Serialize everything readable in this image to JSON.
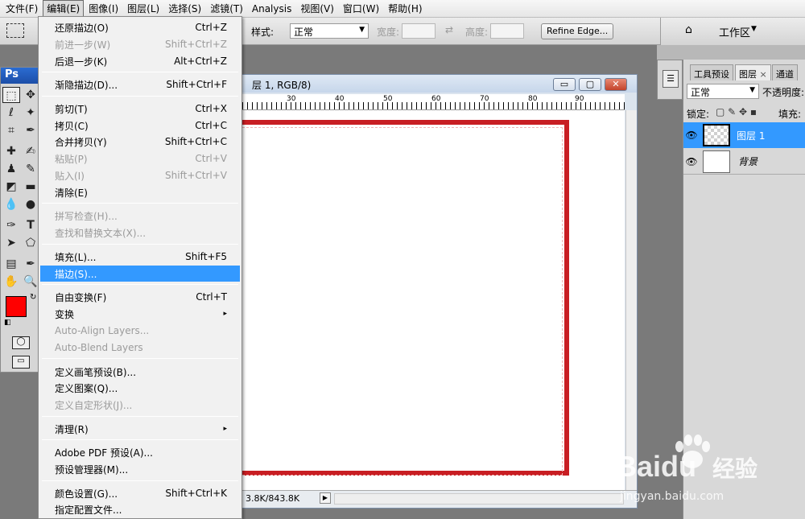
{
  "menubar": {
    "items": [
      "文件(F)",
      "编辑(E)",
      "图像(I)",
      "图层(L)",
      "选择(S)",
      "滤镜(T)",
      "Analysis",
      "视图(V)",
      "窗口(W)",
      "帮助(H)"
    ]
  },
  "options": {
    "style_label": "样式:",
    "style_value": "正常",
    "width_label": "宽度:",
    "height_label": "高度:",
    "refine_label": "Refine Edge...",
    "workspace_label": "工作区"
  },
  "toolbox": {
    "title": "Ps"
  },
  "document": {
    "title": "层 1, RGB/8)",
    "ruler_numbers": [
      "30",
      "40",
      "50",
      "60",
      "70",
      "80",
      "90"
    ],
    "status_text": "3.8K/843.8K",
    "win_minimize": "▭",
    "win_maximize": "▢",
    "win_close": "✕"
  },
  "edit_menu": {
    "items": [
      {
        "label": "还原描边(O)",
        "shortcut": "Ctrl+Z",
        "disabled": false
      },
      {
        "label": "前进一步(W)",
        "shortcut": "Shift+Ctrl+Z",
        "disabled": true
      },
      {
        "label": "后退一步(K)",
        "shortcut": "Alt+Ctrl+Z",
        "disabled": false
      },
      {
        "label": "渐隐描边(D)...",
        "shortcut": "Shift+Ctrl+F",
        "disabled": false
      },
      {
        "label": "剪切(T)",
        "shortcut": "Ctrl+X",
        "disabled": false
      },
      {
        "label": "拷贝(C)",
        "shortcut": "Ctrl+C",
        "disabled": false
      },
      {
        "label": "合并拷贝(Y)",
        "shortcut": "Shift+Ctrl+C",
        "disabled": false
      },
      {
        "label": "粘贴(P)",
        "shortcut": "Ctrl+V",
        "disabled": true
      },
      {
        "label": "贴入(I)",
        "shortcut": "Shift+Ctrl+V",
        "disabled": true
      },
      {
        "label": "清除(E)",
        "shortcut": "",
        "disabled": false
      },
      {
        "label": "拼写检查(H)...",
        "shortcut": "",
        "disabled": true
      },
      {
        "label": "查找和替换文本(X)...",
        "shortcut": "",
        "disabled": true
      },
      {
        "label": "填充(L)...",
        "shortcut": "Shift+F5",
        "disabled": false
      },
      {
        "label": "描边(S)...",
        "shortcut": "",
        "disabled": false,
        "highlight": true
      },
      {
        "label": "自由变换(F)",
        "shortcut": "Ctrl+T",
        "disabled": false
      },
      {
        "label": "变换",
        "shortcut": "▸",
        "disabled": false
      },
      {
        "label": "Auto-Align Layers...",
        "shortcut": "",
        "disabled": true
      },
      {
        "label": "Auto-Blend Layers",
        "shortcut": "",
        "disabled": true
      },
      {
        "label": "定义画笔预设(B)...",
        "shortcut": "",
        "disabled": false
      },
      {
        "label": "定义图案(Q)...",
        "shortcut": "",
        "disabled": false
      },
      {
        "label": "定义自定形状(J)...",
        "shortcut": "",
        "disabled": true
      },
      {
        "label": "清理(R)",
        "shortcut": "▸",
        "disabled": false
      },
      {
        "label": "Adobe PDF 预设(A)...",
        "shortcut": "",
        "disabled": false
      },
      {
        "label": "预设管理器(M)...",
        "shortcut": "",
        "disabled": false
      },
      {
        "label": "颜色设置(G)...",
        "shortcut": "Shift+Ctrl+K",
        "disabled": false
      },
      {
        "label": "指定配置文件...",
        "shortcut": "",
        "disabled": false
      }
    ]
  },
  "layers_panel": {
    "tabs": [
      "工具预设",
      "图层",
      "通道"
    ],
    "tab_close": "×",
    "blend_mode": "正常",
    "opacity_label": "不透明度:",
    "lock_label": "锁定:",
    "fill_label": "填充:",
    "layers": [
      {
        "name": "图层 1",
        "selected": true
      },
      {
        "name": "背景",
        "selected": false
      }
    ]
  },
  "watermark": {
    "brand": "Baidu",
    "brand_cn": "经验",
    "url": "jingyan.baidu.com"
  },
  "colors": {
    "accent": "#3399ff",
    "stroke_red": "#c81e23",
    "foreground": "#ff0000"
  }
}
